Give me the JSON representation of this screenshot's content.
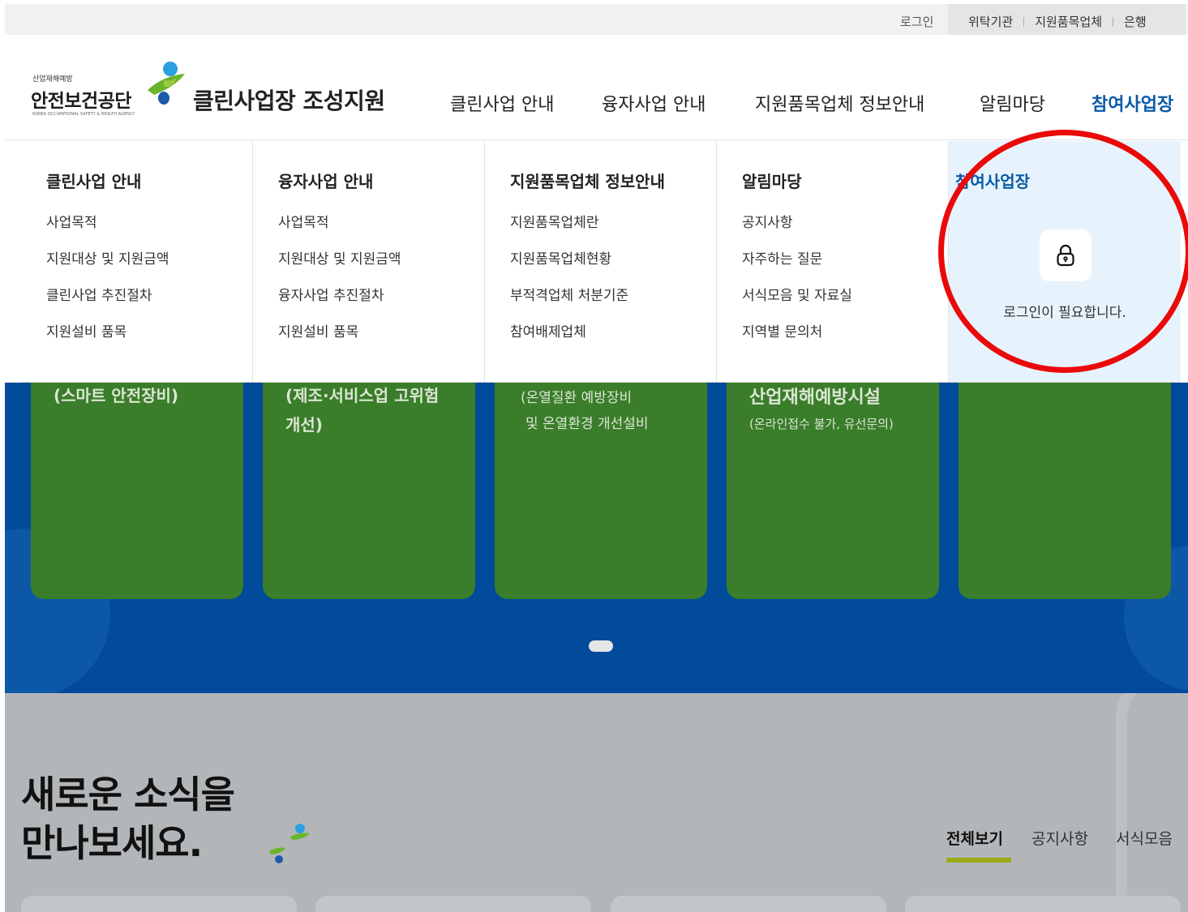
{
  "utility": {
    "login": "로그인",
    "links": [
      "위탁기관",
      "지원품목업체",
      "은행"
    ]
  },
  "header": {
    "org_small": "산업재해예방",
    "org_name": "안전보건공단",
    "org_eng": "KOREA OCCUPATIONAL SAFETY & HEALTH AGENCY",
    "site_title": "클린사업장 조성지원",
    "nav": [
      "클린사업 안내",
      "융자사업 안내",
      "지원품목업체 정보안내",
      "알림마당",
      "참여사업장"
    ]
  },
  "mega_menu": {
    "columns": [
      {
        "title": "클린사업 안내",
        "items": [
          "사업목적",
          "지원대상 및 지원금액",
          "클린사업 추진절차",
          "지원설비 품목"
        ]
      },
      {
        "title": "융자사업 안내",
        "items": [
          "사업목적",
          "지원대상 및 지원금액",
          "융자사업 추진절차",
          "지원설비 품목"
        ]
      },
      {
        "title": "지원품목업체 정보안내",
        "items": [
          "지원품목업체란",
          "지원품목업체현황",
          "부적격업체 처분기준",
          "참여배제업체"
        ]
      },
      {
        "title": "알림마당",
        "items": [
          "공지사항",
          "자주하는 질문",
          "서식모음 및 자료실",
          "지역별 문의처"
        ]
      }
    ],
    "participant": {
      "title": "참여사업장",
      "lock_icon": "lock-icon",
      "message": "로그인이 필요합니다."
    }
  },
  "hero": {
    "cards": [
      {
        "lines": [
          "(스마트 안전장비)"
        ]
      },
      {
        "lines": [
          "(제조·서비스업 고위험",
          "개선)"
        ]
      },
      {
        "lines": [
          "(온열질환 예방장비",
          "및 온열환경 개선설비"
        ]
      },
      {
        "lines": [
          "산업재해예방시설",
          "(온라인접수 불가, 유선문의)"
        ]
      },
      {
        "lines": []
      }
    ]
  },
  "news": {
    "title_line1": "새로운 소식을",
    "title_line2": "만나보세요.",
    "tabs": [
      "전체보기",
      "공지사항",
      "서식모음"
    ],
    "active_tab": "전체보기"
  },
  "colors": {
    "brand_blue": "#0a5aa8",
    "hero_blue": "#024a9a",
    "card_green": "#3a7d2a",
    "highlight_red": "#ea0a0a",
    "tab_underline": "#9aab17"
  }
}
